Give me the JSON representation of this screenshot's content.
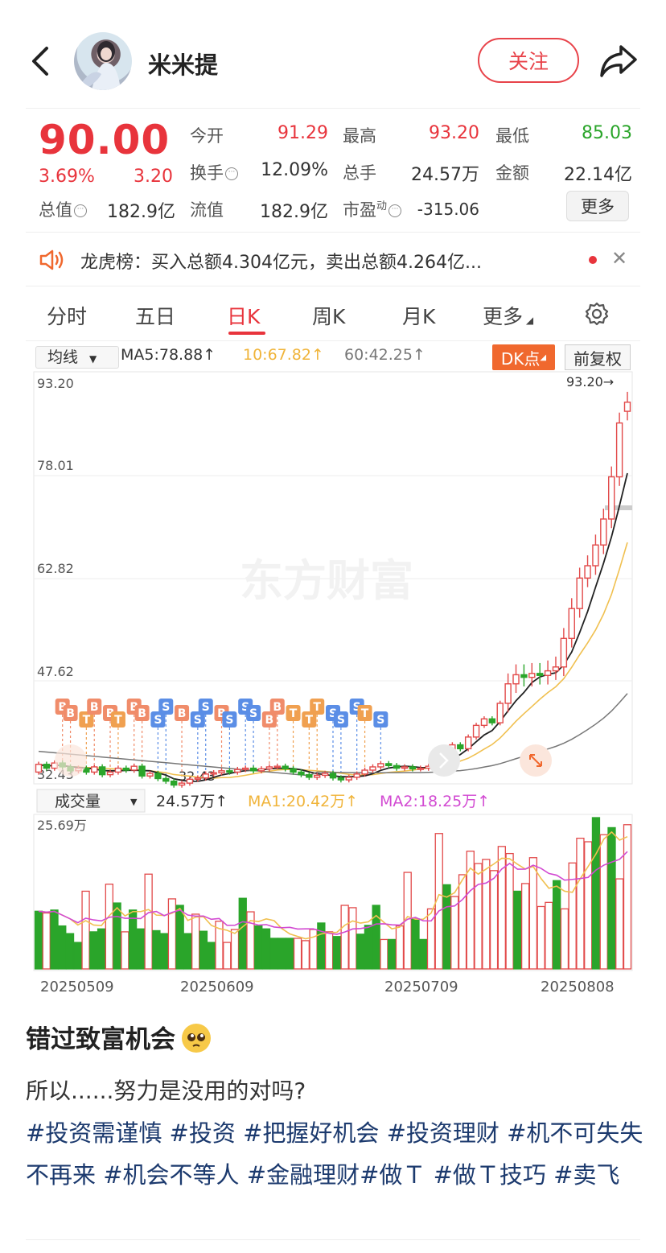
{
  "header": {
    "username": "米米提",
    "follow_label": "关注"
  },
  "quote": {
    "price": "90.00",
    "change_pct": "3.69%",
    "change_val": "3.20",
    "fields": [
      {
        "label": "今开",
        "value": "91.29",
        "color": "red"
      },
      {
        "label": "最高",
        "value": "93.20",
        "color": "red"
      },
      {
        "label": "最低",
        "value": "85.03",
        "color": "green"
      },
      {
        "label": "换手",
        "value": "12.09%",
        "color": "normal"
      },
      {
        "label": "总手",
        "value": "24.57万",
        "color": "normal"
      },
      {
        "label": "金额",
        "value": "22.14亿",
        "color": "normal"
      },
      {
        "label": "总值",
        "value": "182.9亿",
        "color": "normal"
      },
      {
        "label": "流值",
        "value": "182.9亿",
        "color": "normal"
      },
      {
        "label": "市盈",
        "value": "-315.06",
        "color": "normal",
        "superscript": "动"
      }
    ],
    "more_label": "更多"
  },
  "banner": {
    "text": "龙虎榜：买入总额4.304亿元，卖出总额4.264亿..."
  },
  "tabs": [
    "分时",
    "五日",
    "日K",
    "周K",
    "月K",
    "更多"
  ],
  "active_tab": "日K",
  "chart_toolbar": {
    "ma_select": "均线",
    "ma5": "MA5:78.88↑",
    "ma10": "10:67.82↑",
    "ma60": "60:42.25↑",
    "dk_label": "DK点",
    "fq_label": "前复权"
  },
  "volume_toolbar": {
    "select": "成交量",
    "vol": "24.57万↑",
    "ma1": "MA1:20.42万↑",
    "ma2": "MA2:18.25万↑"
  },
  "watermark": "东方财富",
  "chart_data": {
    "type": "candlestick",
    "price_axis_labels": [
      "93.20",
      "78.01",
      "62.82",
      "47.62",
      "32.43"
    ],
    "ylim": [
      32.43,
      93.2
    ],
    "high_marker": "93.20→",
    "low_marker": "32.43",
    "volume_max_label": "25.69万",
    "date_labels": [
      "20250509",
      "20250609",
      "20250709",
      "20250808"
    ],
    "candles": [
      {
        "o": 33.0,
        "c": 34.2
      },
      {
        "o": 34.2,
        "c": 33.6
      },
      {
        "o": 33.6,
        "c": 34.4
      },
      {
        "o": 34.4,
        "c": 33.8
      },
      {
        "o": 33.8,
        "c": 33.2
      },
      {
        "o": 33.2,
        "c": 33.6
      },
      {
        "o": 33.6,
        "c": 33.0
      },
      {
        "o": 33.0,
        "c": 33.8
      },
      {
        "o": 33.8,
        "c": 32.6
      },
      {
        "o": 32.6,
        "c": 33.0
      },
      {
        "o": 33.0,
        "c": 33.6
      },
      {
        "o": 33.6,
        "c": 33.3
      },
      {
        "o": 33.3,
        "c": 33.9
      },
      {
        "o": 33.9,
        "c": 32.4
      },
      {
        "o": 32.4,
        "c": 32.8
      },
      {
        "o": 32.8,
        "c": 32.0
      },
      {
        "o": 32.0,
        "c": 31.6
      },
      {
        "o": 31.6,
        "c": 31.0
      },
      {
        "o": 31.0,
        "c": 31.3
      },
      {
        "o": 31.3,
        "c": 31.9
      },
      {
        "o": 31.9,
        "c": 32.1
      },
      {
        "o": 32.1,
        "c": 32.7
      },
      {
        "o": 32.7,
        "c": 32.9
      },
      {
        "o": 32.9,
        "c": 33.2
      },
      {
        "o": 33.2,
        "c": 33.0
      },
      {
        "o": 33.0,
        "c": 33.4
      },
      {
        "o": 33.4,
        "c": 33.6
      },
      {
        "o": 33.6,
        "c": 33.2
      },
      {
        "o": 33.2,
        "c": 33.5
      },
      {
        "o": 33.5,
        "c": 33.8
      },
      {
        "o": 33.8,
        "c": 33.9
      },
      {
        "o": 33.9,
        "c": 33.5
      },
      {
        "o": 33.5,
        "c": 33.0
      },
      {
        "o": 33.0,
        "c": 32.6
      },
      {
        "o": 32.6,
        "c": 32.2
      },
      {
        "o": 32.2,
        "c": 32.5
      },
      {
        "o": 32.5,
        "c": 32.8
      },
      {
        "o": 32.8,
        "c": 32.1
      },
      {
        "o": 32.1,
        "c": 31.8
      },
      {
        "o": 31.8,
        "c": 32.2
      },
      {
        "o": 32.2,
        "c": 32.7
      },
      {
        "o": 32.7,
        "c": 33.3
      },
      {
        "o": 33.3,
        "c": 33.8
      },
      {
        "o": 33.8,
        "c": 34.3
      },
      {
        "o": 34.3,
        "c": 34.0
      },
      {
        "o": 34.0,
        "c": 33.6
      },
      {
        "o": 33.6,
        "c": 33.8
      },
      {
        "o": 33.8,
        "c": 33.5
      },
      {
        "o": 33.5,
        "c": 33.6
      },
      {
        "o": 33.6,
        "c": 33.9
      },
      {
        "o": 33.9,
        "c": 34.8
      },
      {
        "o": 34.8,
        "c": 36.0
      },
      {
        "o": 36.0,
        "c": 37.2
      },
      {
        "o": 37.2,
        "c": 36.6
      },
      {
        "o": 36.6,
        "c": 38.4
      },
      {
        "o": 38.4,
        "c": 40.2
      },
      {
        "o": 40.2,
        "c": 41.2
      },
      {
        "o": 41.2,
        "c": 40.6
      },
      {
        "o": 40.6,
        "c": 43.6
      },
      {
        "o": 43.6,
        "c": 46.6
      },
      {
        "o": 46.6,
        "c": 48.0
      },
      {
        "o": 48.0,
        "c": 47.6
      },
      {
        "o": 47.6,
        "c": 48.2
      },
      {
        "o": 48.2,
        "c": 47.9
      },
      {
        "o": 47.9,
        "c": 48.6
      },
      {
        "o": 48.6,
        "c": 49.2
      },
      {
        "o": 49.2,
        "c": 53.6
      },
      {
        "o": 53.6,
        "c": 58.2
      },
      {
        "o": 58.2,
        "c": 62.9
      },
      {
        "o": 62.9,
        "c": 64.8
      },
      {
        "o": 64.8,
        "c": 68.0
      },
      {
        "o": 68.0,
        "c": 72.0
      },
      {
        "o": 72.0,
        "c": 78.5
      },
      {
        "o": 78.5,
        "c": 86.8
      },
      {
        "o": 88.6,
        "c": 90.0
      }
    ],
    "volumes": [
      {
        "v": 9.8,
        "up": false
      },
      {
        "v": 9.5,
        "up": true
      },
      {
        "v": 10.0,
        "up": false
      },
      {
        "v": 7.3,
        "up": false
      },
      {
        "v": 6.0,
        "up": false
      },
      {
        "v": 4.5,
        "up": false
      },
      {
        "v": 13.2,
        "up": true
      },
      {
        "v": 6.3,
        "up": false
      },
      {
        "v": 6.8,
        "up": false
      },
      {
        "v": 14.4,
        "up": true
      },
      {
        "v": 11.2,
        "up": false
      },
      {
        "v": 6.3,
        "up": true
      },
      {
        "v": 10.0,
        "up": false
      },
      {
        "v": 6.8,
        "up": false
      },
      {
        "v": 16.1,
        "up": true
      },
      {
        "v": 6.5,
        "up": false
      },
      {
        "v": 6.0,
        "up": false
      },
      {
        "v": 11.9,
        "up": true
      },
      {
        "v": 10.8,
        "up": false
      },
      {
        "v": 6.0,
        "up": false
      },
      {
        "v": 9.3,
        "up": true
      },
      {
        "v": 6.4,
        "up": false
      },
      {
        "v": 4.5,
        "up": false
      },
      {
        "v": 8.1,
        "up": true
      },
      {
        "v": 4.5,
        "up": true
      },
      {
        "v": 6.7,
        "up": true
      },
      {
        "v": 12.0,
        "up": false
      },
      {
        "v": 9.7,
        "up": true
      },
      {
        "v": 7.3,
        "up": false
      },
      {
        "v": 6.8,
        "up": false
      },
      {
        "v": 5.2,
        "up": false
      },
      {
        "v": 5.2,
        "up": false
      },
      {
        "v": 5.2,
        "up": false
      },
      {
        "v": 5.2,
        "up": true
      },
      {
        "v": 4.8,
        "up": true
      },
      {
        "v": 6.7,
        "up": true
      },
      {
        "v": 7.8,
        "up": false
      },
      {
        "v": 6.3,
        "up": true
      },
      {
        "v": 5.5,
        "up": false
      },
      {
        "v": 10.8,
        "up": true
      },
      {
        "v": 10.4,
        "up": true
      },
      {
        "v": 5.9,
        "up": false
      },
      {
        "v": 7.4,
        "up": false
      },
      {
        "v": 10.8,
        "up": false
      },
      {
        "v": 5.0,
        "up": true
      },
      {
        "v": 5.0,
        "up": false
      },
      {
        "v": 7.3,
        "up": true
      },
      {
        "v": 16.4,
        "up": true
      },
      {
        "v": 8.5,
        "up": false
      },
      {
        "v": 5.0,
        "up": false
      },
      {
        "v": 10.2,
        "up": true
      },
      {
        "v": 23.0,
        "up": true
      },
      {
        "v": 14.3,
        "up": false
      },
      {
        "v": 12.3,
        "up": true
      },
      {
        "v": 16.0,
        "up": true
      },
      {
        "v": 20.0,
        "up": true
      },
      {
        "v": 17.9,
        "up": true
      },
      {
        "v": 18.6,
        "up": true
      },
      {
        "v": 16.7,
        "up": true
      },
      {
        "v": 20.8,
        "up": true
      },
      {
        "v": 19.6,
        "up": true
      },
      {
        "v": 13.2,
        "up": false
      },
      {
        "v": 14.5,
        "up": true
      },
      {
        "v": 18.9,
        "up": true
      },
      {
        "v": 10.6,
        "up": true
      },
      {
        "v": 11.3,
        "up": true
      },
      {
        "v": 15.0,
        "up": false
      },
      {
        "v": 10.2,
        "up": true
      },
      {
        "v": 18.0,
        "up": true
      },
      {
        "v": 22.2,
        "up": true
      },
      {
        "v": 21.6,
        "up": true
      },
      {
        "v": 25.7,
        "up": false
      },
      {
        "v": 22.8,
        "up": true
      },
      {
        "v": 24.0,
        "up": false
      },
      {
        "v": 15.3,
        "up": true
      },
      {
        "v": 24.5,
        "up": true
      }
    ]
  },
  "post": {
    "title": "错过致富机会",
    "body": "所以......努力是没用的对吗?",
    "tags": [
      "#投资需谨慎",
      "#投资",
      "#把握好机会",
      "#投资理财",
      "#机不可失失不再来",
      "#机会不等人",
      "#金融理财",
      "#做Ｔ",
      "#做Ｔ技巧",
      "#卖飞"
    ]
  }
}
